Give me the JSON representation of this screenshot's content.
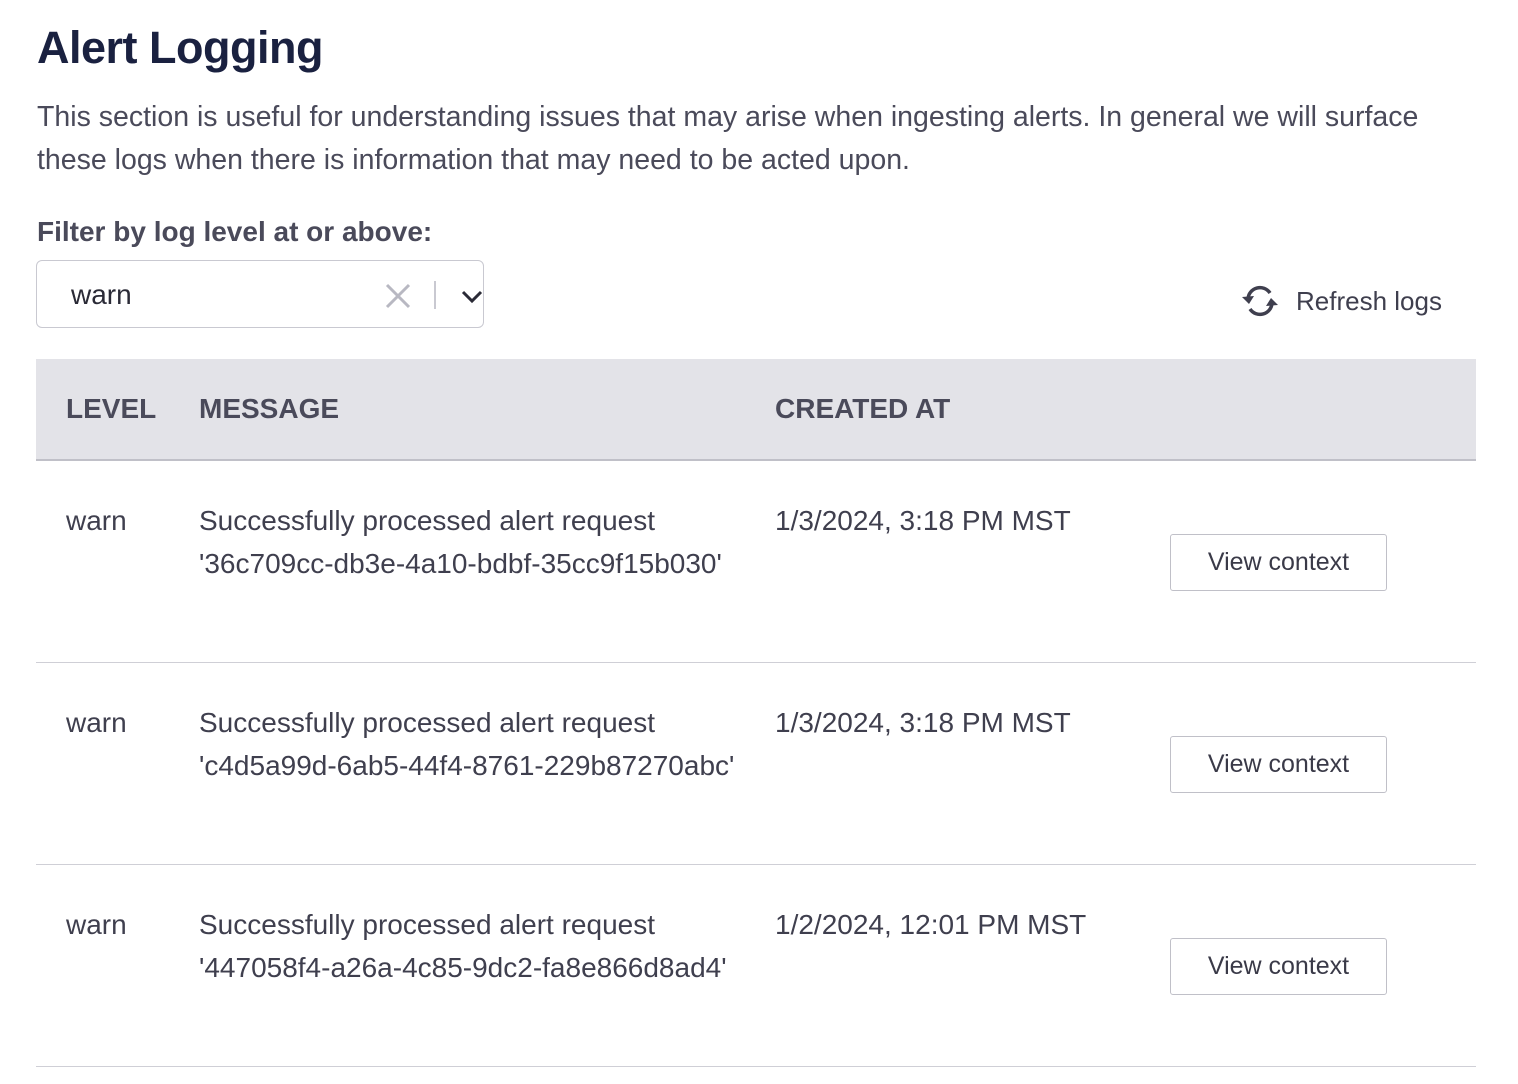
{
  "page": {
    "title": "Alert Logging",
    "description": "This section is useful for understanding issues that may arise when ingesting alerts. In general we will surface these logs when there is information that may need to be acted upon."
  },
  "filter": {
    "label": "Filter by log level at or above:",
    "value": "warn",
    "clear_icon": "close-icon",
    "dropdown_icon": "chevron-down-icon"
  },
  "refresh": {
    "label": "Refresh logs",
    "icon": "refresh-icon"
  },
  "table": {
    "headers": {
      "level": "LEVEL",
      "message": "MESSAGE",
      "created_at": "CREATED AT"
    },
    "rows": [
      {
        "level": "warn",
        "message": "Successfully processed alert request '36c709cc-db3e-4a10-bdbf-35cc9f15b030'",
        "created_at": "1/3/2024, 3:18 PM MST",
        "action": "View context"
      },
      {
        "level": "warn",
        "message": "Successfully processed alert request 'c4d5a99d-6ab5-44f4-8761-229b87270abc'",
        "created_at": "1/3/2024, 3:18 PM MST",
        "action": "View context"
      },
      {
        "level": "warn",
        "message": "Successfully processed alert request '447058f4-a26a-4c85-9dc2-fa8e866d8ad4'",
        "created_at": "1/2/2024, 12:01 PM MST",
        "action": "View context"
      }
    ]
  },
  "colors": {
    "title": "#1a2140",
    "header_bg": "#e3e3e8",
    "text": "#3f3f4e"
  }
}
